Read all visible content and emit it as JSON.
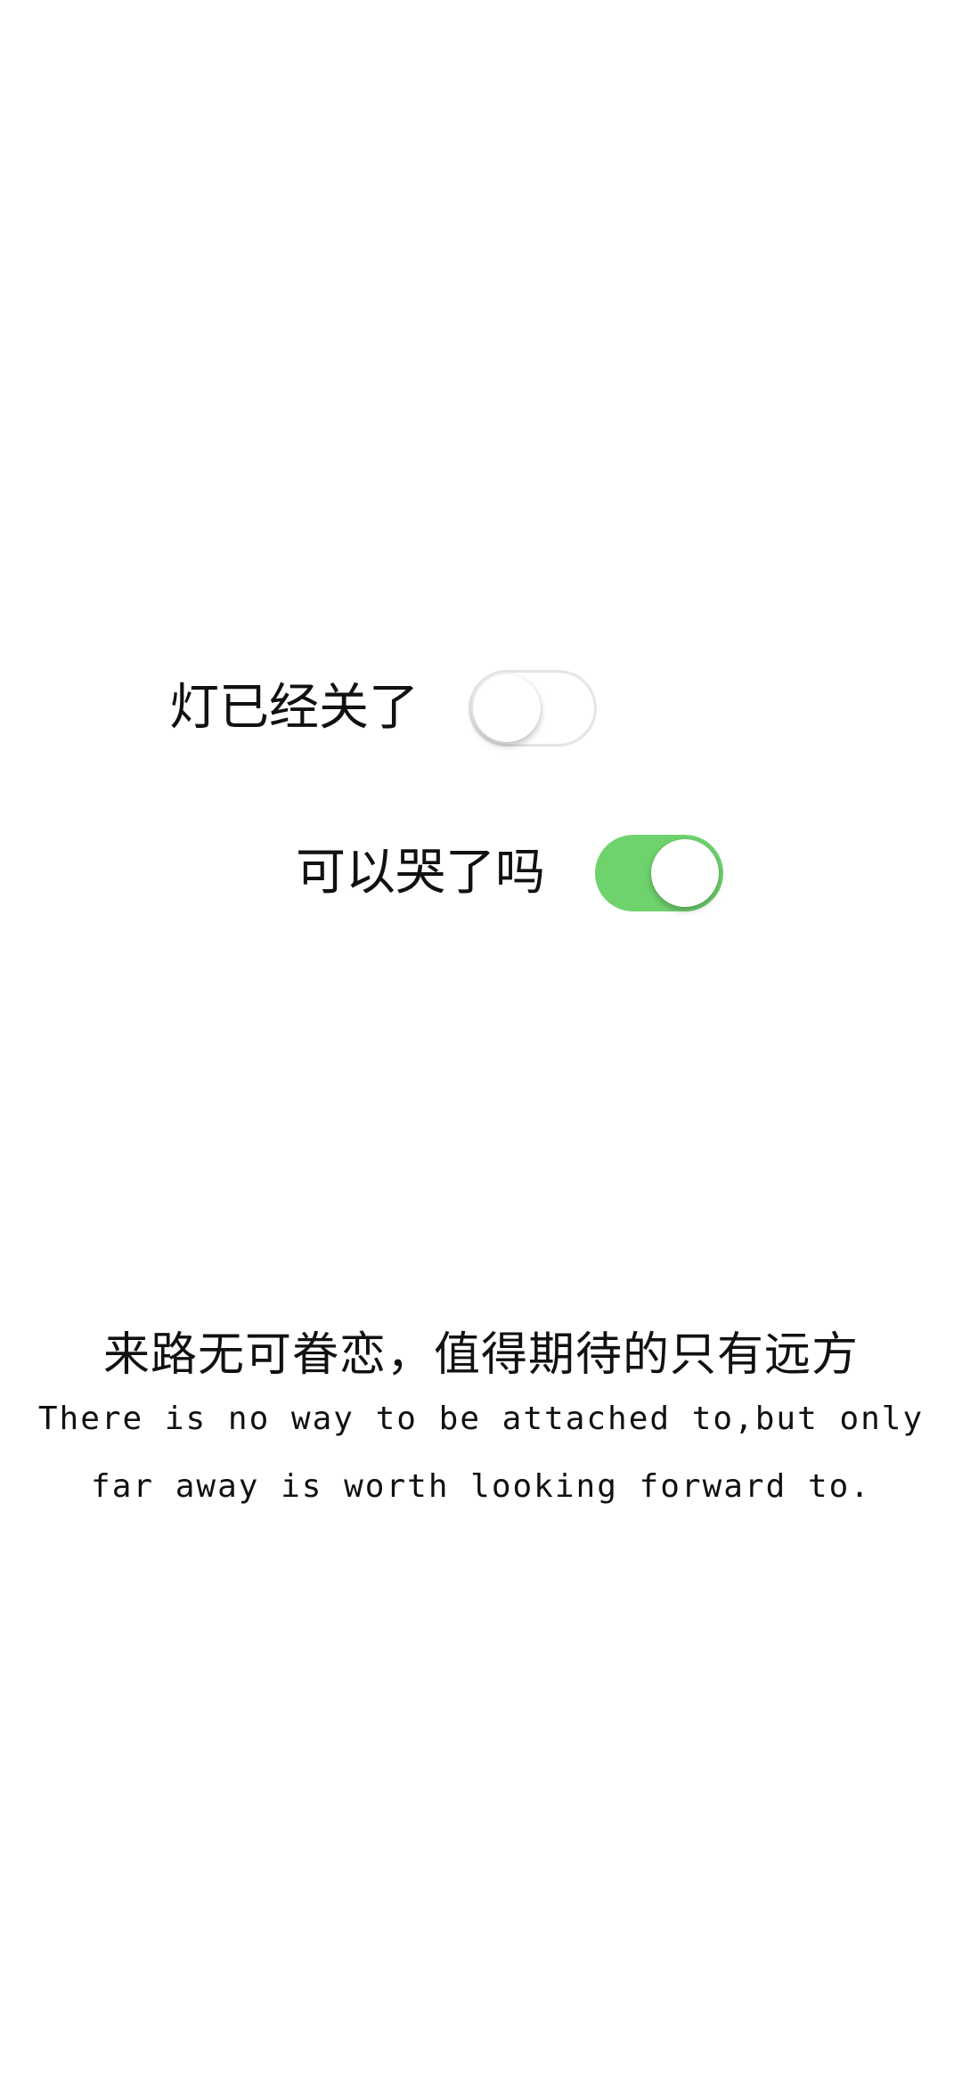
{
  "toggles": [
    {
      "label": "灯已经关了",
      "state": "off"
    },
    {
      "label": "可以哭了吗",
      "state": "on"
    }
  ],
  "quote": {
    "chinese": "来路无可眷恋，值得期待的只有远方",
    "english_line1": "There is no way to be attached to,but only",
    "english_line2": "far away is worth looking forward to."
  },
  "colors": {
    "toggle_on": "#6fd36d",
    "toggle_off_border": "#e5e5e5",
    "background": "#ffffff",
    "text": "#111111"
  }
}
